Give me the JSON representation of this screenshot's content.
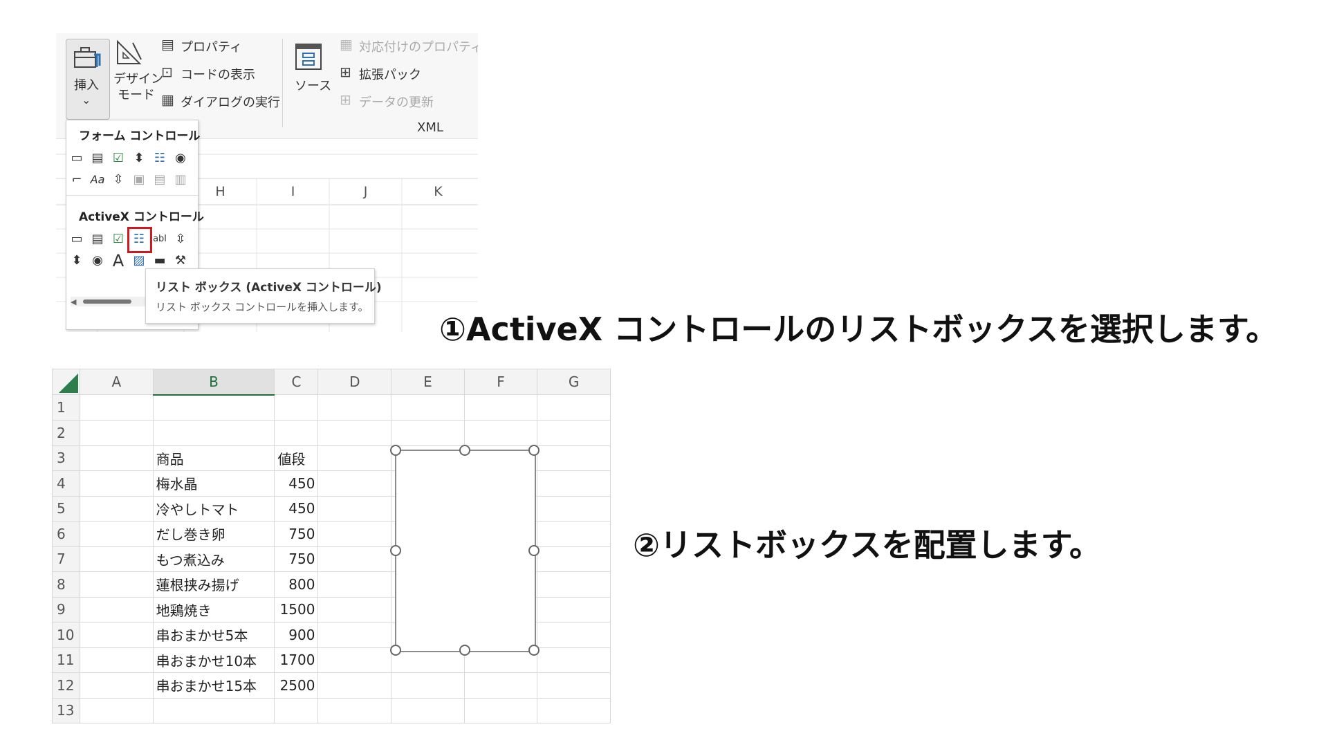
{
  "ribbon": {
    "insert_label": "挿入",
    "design_mode_line1": "デザイン",
    "design_mode_line2": "モード",
    "properties": "プロパティ",
    "view_code": "コードの表示",
    "run_dialog": "ダイアログの実行",
    "source": "ソース",
    "map_properties": "対応付けのプロパティ",
    "expansion_packs": "拡張パック",
    "refresh_data": "データの更新",
    "xml_group": "XML",
    "chevron": "⌄"
  },
  "top_columns": [
    "H",
    "I",
    "J",
    "K"
  ],
  "dropdown": {
    "form_controls_title": "フォーム コントロール",
    "activex_title": "ActiveX コントロール"
  },
  "tooltip": {
    "title": "リスト ボックス (ActiveX コントロール)",
    "description": "リスト ボックス コントロールを挿入します。"
  },
  "captions": {
    "step1": "①ActiveX コントロールのリストボックスを選択します。",
    "step2": "②リストボックスを配置します。"
  },
  "sheet": {
    "columns": [
      "A",
      "B",
      "C",
      "D",
      "E",
      "F",
      "G"
    ],
    "selected_column": "B",
    "rows": [
      {
        "n": "1",
        "b": "",
        "c": ""
      },
      {
        "n": "2",
        "b": "",
        "c": ""
      },
      {
        "n": "3",
        "b": "商品",
        "c": "値段"
      },
      {
        "n": "4",
        "b": "梅水晶",
        "c": "450"
      },
      {
        "n": "5",
        "b": "冷やしトマト",
        "c": "450"
      },
      {
        "n": "6",
        "b": "だし巻き卵",
        "c": "750"
      },
      {
        "n": "7",
        "b": "もつ煮込み",
        "c": "750"
      },
      {
        "n": "8",
        "b": "蓮根挟み揚げ",
        "c": "800"
      },
      {
        "n": "9",
        "b": "地鶏焼き",
        "c": "1500"
      },
      {
        "n": "10",
        "b": "串おまかせ5本",
        "c": "900"
      },
      {
        "n": "11",
        "b": "串おまかせ10本",
        "c": "1700"
      },
      {
        "n": "12",
        "b": "串おまかせ15本",
        "c": "2500"
      },
      {
        "n": "13",
        "b": "",
        "c": ""
      }
    ]
  }
}
